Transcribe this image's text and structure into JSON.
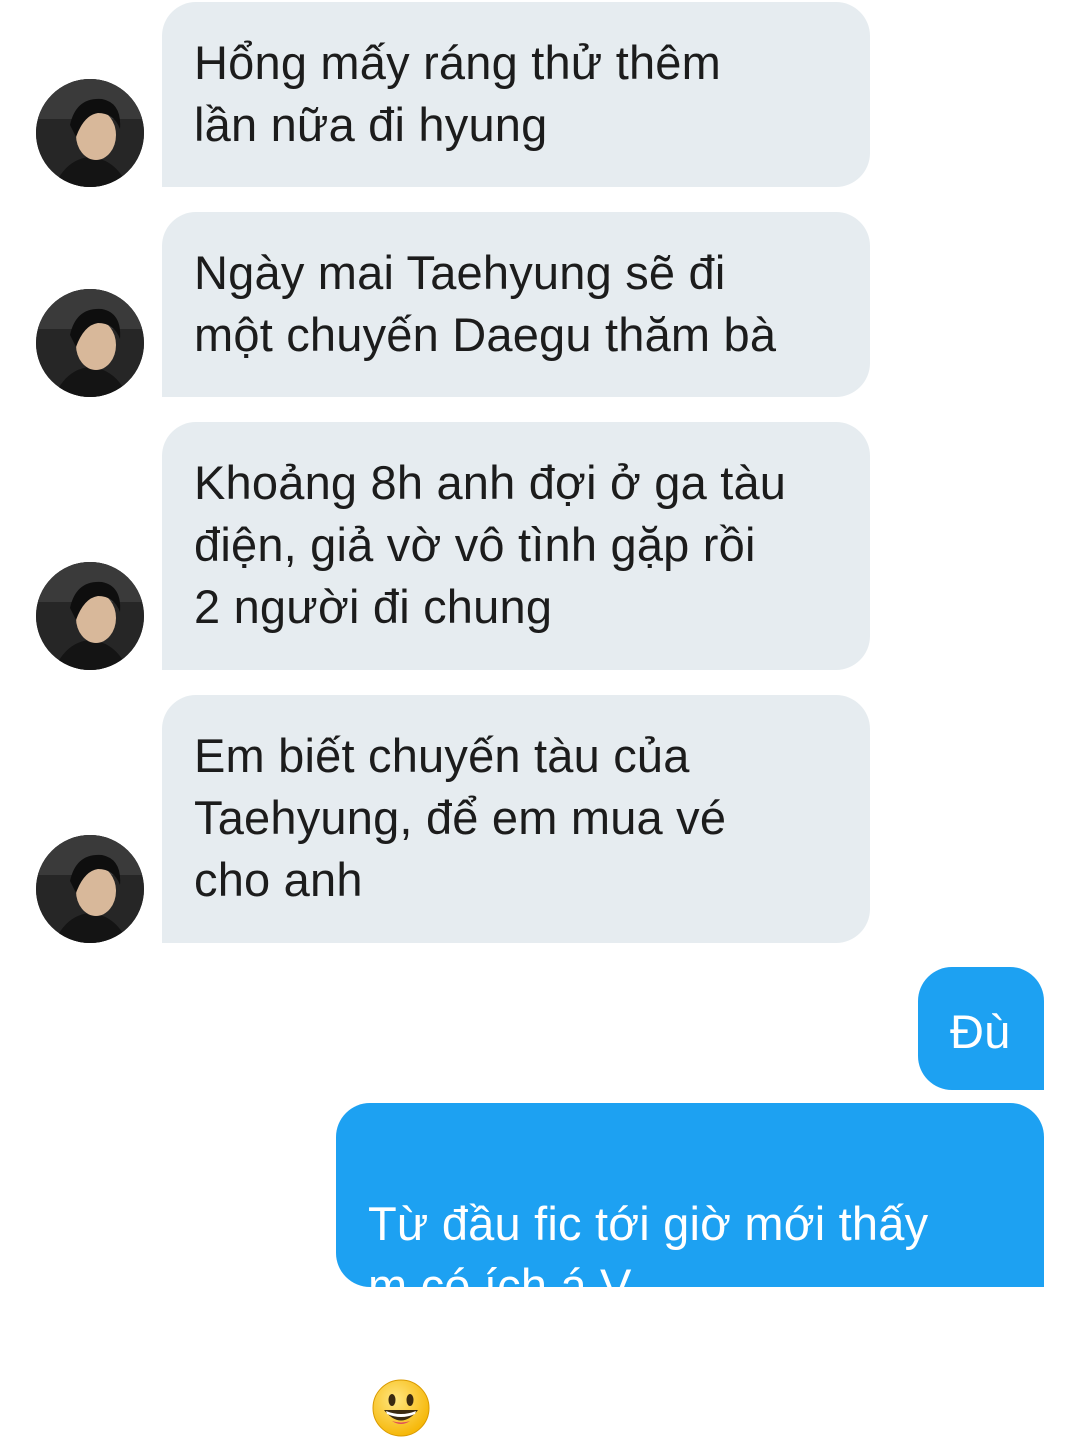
{
  "conversation": {
    "incoming": [
      {
        "text": "Hổng mấy ráng thử thêm\nlần nữa đi hyung"
      },
      {
        "text": "Ngày mai Taehyung sẽ đi\nmột chuyến Daegu thăm bà"
      },
      {
        "text": "Khoảng 8h anh đợi ở ga tàu\nđiện, giả vờ vô tình gặp rồi\n2 người đi chung"
      },
      {
        "text": "Em biết chuyến tàu của\nTaehyung, để em mua vé\ncho anh"
      }
    ],
    "outgoing": [
      {
        "text": "Đù"
      },
      {
        "text": "Từ đầu fic tới giờ mới thấy\nm có ích á V"
      }
    ]
  },
  "colors": {
    "incoming_bubble": "#e6ecf0",
    "outgoing_bubble": "#1da1f2",
    "incoming_text": "#1c1c1c",
    "outgoing_text": "#ffffff"
  },
  "icons": {
    "avatar": "user-photo-avatar",
    "emoji": "grinning-face-emoji"
  }
}
